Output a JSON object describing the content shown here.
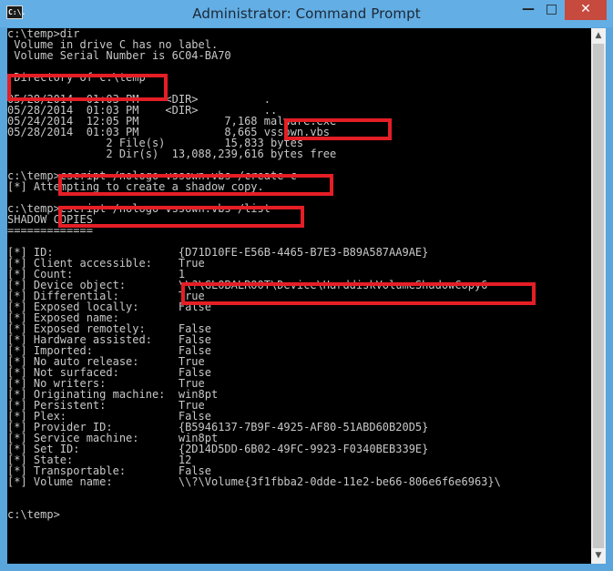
{
  "window": {
    "title": "Administrator: Command Prompt",
    "icon_name": "command-prompt-icon",
    "icon_text": "C:\\.",
    "controls": {
      "minimize": "—",
      "maximize": "□",
      "close": "✕"
    }
  },
  "console": {
    "lines": [
      "c:\\temp>dir",
      " Volume in drive C has no label.",
      " Volume Serial Number is 6C04-BA70",
      "",
      " Directory of c:\\temp",
      "",
      "05/28/2014  01:03 PM    <DIR>          .",
      "05/28/2014  01:03 PM    <DIR>          ..",
      "05/24/2014  12:05 PM             7,168 malware.exe",
      "05/28/2014  01:03 PM             8,665 vssown.vbs",
      "               2 File(s)         15,833 bytes",
      "               2 Dir(s)  13,088,239,616 bytes free",
      "",
      "c:\\temp>cscript /nologo vssown.vbs /create c",
      "[*] Attempting to create a shadow copy.",
      "",
      "c:\\temp>cscript /nologo vssown.vbs /list",
      "SHADOW COPIES",
      "=============",
      "",
      "[*] ID:                   {D71D10FE-E56B-4465-B7E3-B89A587AA9AE}",
      "[*] Client accessible:    True",
      "[*] Count:                1",
      "[*] Device object:        \\\\?\\GLOBALROOT\\Device\\HarddiskVolumeShadowCopy6",
      "[*] Differential:         True",
      "[*] Exposed locally:      False",
      "[*] Exposed name:",
      "[*] Exposed remotely:     False",
      "[*] Hardware assisted:    False",
      "[*] Imported:             False",
      "[*] No auto release:      True",
      "[*] Not surfaced:         False",
      "[*] No writers:           True",
      "[*] Originating machine:  win8pt",
      "[*] Persistent:           True",
      "[*] Plex:                 False",
      "[*] Provider ID:          {B5946137-7B9F-4925-AF80-51ABD60B20D5}",
      "[*] Service machine:      win8pt",
      "[*] Set ID:               {2D14D5DD-6B02-49FC-9923-F0340BEB339E}",
      "[*] State:                12",
      "[*] Transportable:        False",
      "[*] Volume name:          \\\\?\\Volume{3f1fbba2-0dde-11e2-be66-806e6f6e6963}\\",
      "",
      "",
      "c:\\temp>"
    ]
  },
  "highlight_color": "#e51e25"
}
